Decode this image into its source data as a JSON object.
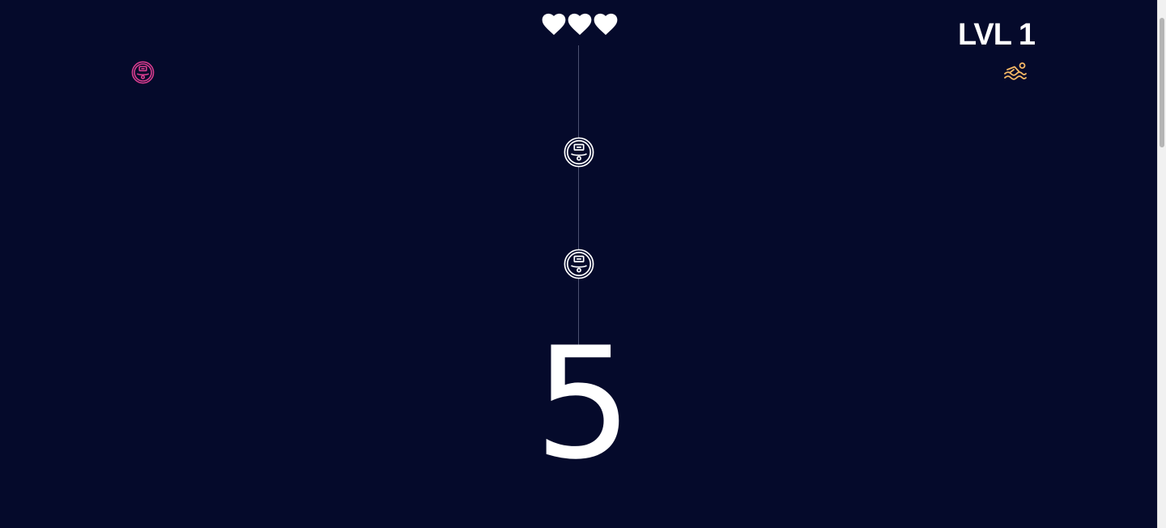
{
  "hud": {
    "lives": 3,
    "level_label": "LVL 1"
  },
  "player": {
    "icon": "robot-vacuum-icon",
    "color": "#d63c8e"
  },
  "obstacles": {
    "icon": "robot-vacuum-icon",
    "color": "#ffffff",
    "count": 2
  },
  "goal": {
    "icon": "swimmer-icon",
    "color": "#f5b865"
  },
  "countdown": {
    "value": "5"
  },
  "colors": {
    "background": "#050a2b",
    "text": "#ffffff",
    "track": "#4b5070"
  }
}
